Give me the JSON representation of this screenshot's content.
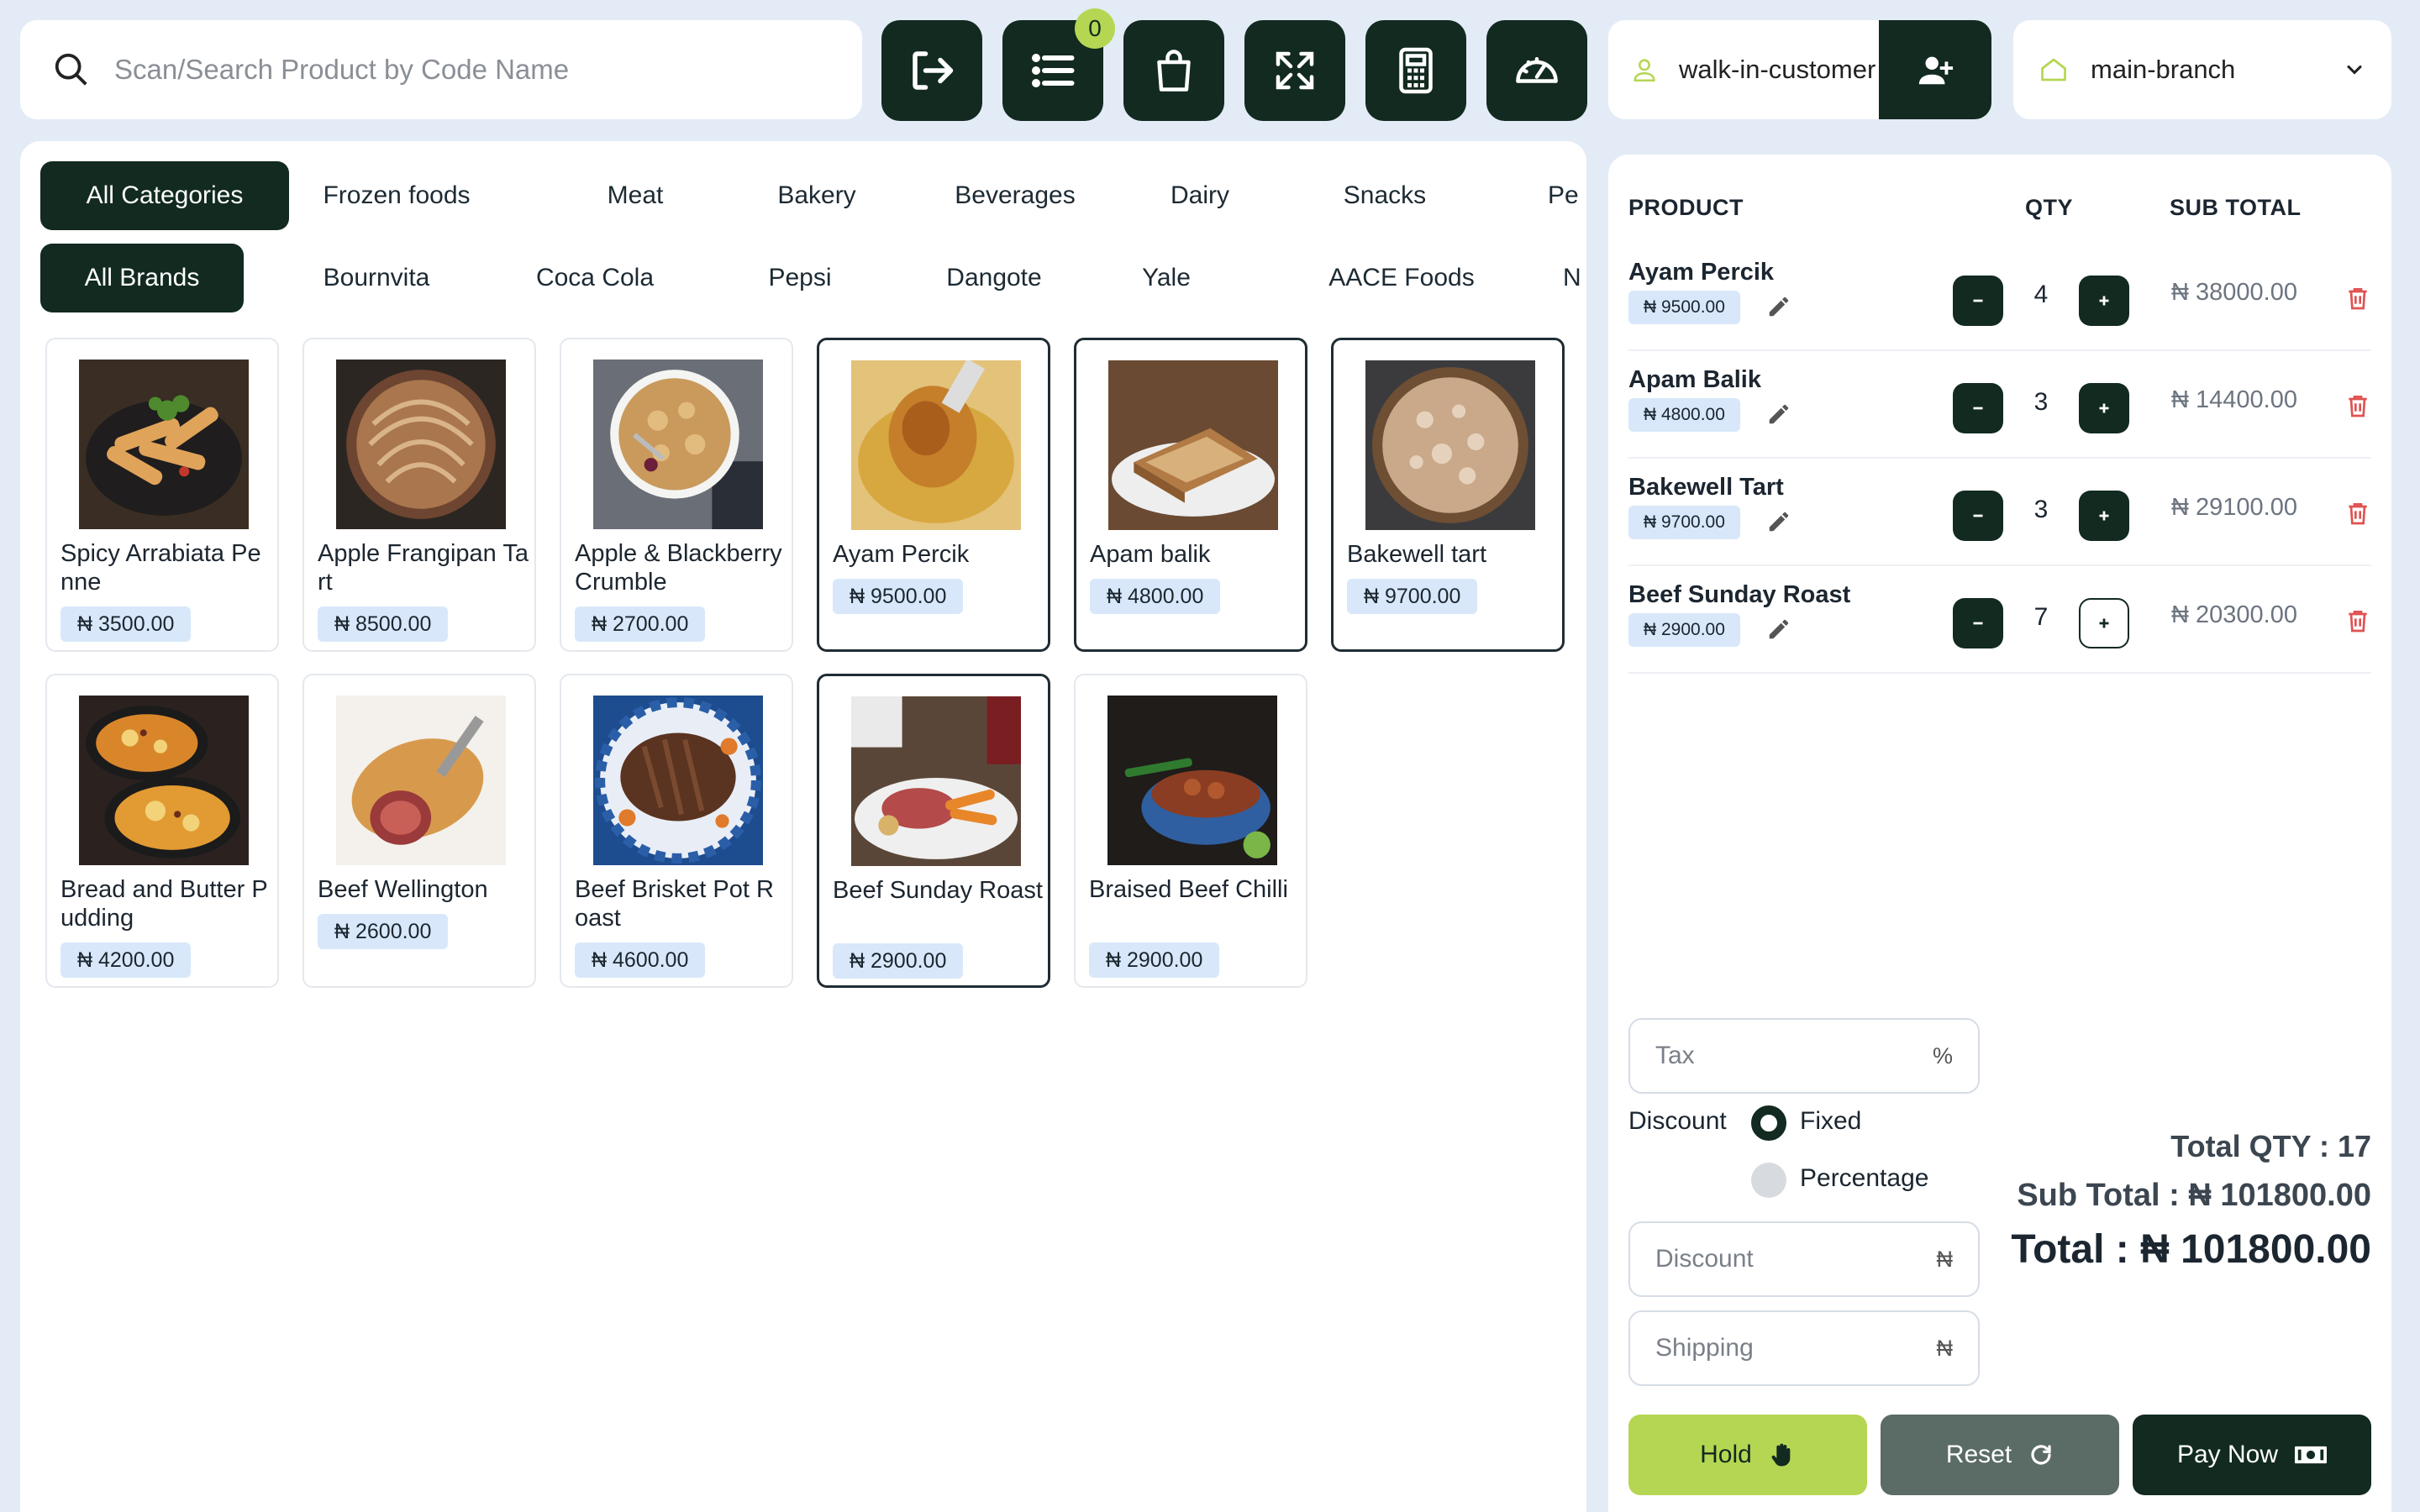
{
  "search": {
    "placeholder": "Scan/Search Product by Code Name",
    "value": ""
  },
  "toolbar": {
    "held_count": "0"
  },
  "customer": {
    "value": "walk-in-customer"
  },
  "branch": {
    "value": "main-branch"
  },
  "categories": [
    "All Categories",
    "Frozen foods",
    "Meat",
    "Bakery",
    "Beverages",
    "Dairy",
    "Snacks",
    "Pe"
  ],
  "brands": [
    "All Brands",
    "Bournvita",
    "Coca Cola",
    "Pepsi",
    "Dangote",
    "Yale",
    "AACE Foods",
    "N"
  ],
  "products": [
    {
      "name": "Spicy Arrabiata Penne",
      "price": "₦ 3500.00"
    },
    {
      "name": "Apple Frangipan Tart",
      "price": "₦ 8500.00"
    },
    {
      "name": "Apple & Blackberry Crumble",
      "price": "₦ 2700.00"
    },
    {
      "name": "Ayam Percik",
      "price": "₦ 9500.00"
    },
    {
      "name": "Apam balik",
      "price": "₦ 4800.00"
    },
    {
      "name": "Bakewell tart",
      "price": "₦ 9700.00"
    },
    {
      "name": "Bread and Butter Pudding",
      "price": "₦ 4200.00"
    },
    {
      "name": "Beef Wellington",
      "price": "₦ 2600.00"
    },
    {
      "name": "Beef Brisket Pot Roast",
      "price": "₦ 4600.00"
    },
    {
      "name": "Beef Sunday Roast",
      "price": "₦ 2900.00"
    },
    {
      "name": "Braised Beef Chilli",
      "price": "₦ 2900.00"
    }
  ],
  "cart": {
    "headers": {
      "product": "PRODUCT",
      "qty": "QTY",
      "subtotal": "SUB TOTAL"
    },
    "items": [
      {
        "name": "Ayam Percik",
        "price": "₦ 9500.00",
        "qty": "4",
        "subtotal": "₦ 38000.00"
      },
      {
        "name": "Apam Balik",
        "price": "₦ 4800.00",
        "qty": "3",
        "subtotal": "₦ 14400.00"
      },
      {
        "name": "Bakewell Tart",
        "price": "₦ 9700.00",
        "qty": "3",
        "subtotal": "₦ 29100.00"
      },
      {
        "name": "Beef Sunday Roast",
        "price": "₦ 2900.00",
        "qty": "7",
        "subtotal": "₦ 20300.00"
      }
    ]
  },
  "summary": {
    "tax_placeholder": "Tax",
    "tax_suffix": "%",
    "discount_label": "Discount",
    "fixed_label": "Fixed",
    "percentage_label": "Percentage",
    "discount_placeholder": "Discount",
    "shipping_placeholder": "Shipping",
    "currency_suffix": "₦",
    "total_qty": "Total QTY : 17",
    "sub_total": "Sub Total : ₦ 101800.00",
    "total": "Total : ₦ 101800.00"
  },
  "actions": {
    "hold": "Hold",
    "reset": "Reset",
    "pay": "Pay Now"
  },
  "colors": {
    "dark_green": "#122a20",
    "lime": "#b5d653",
    "slate": "#5b6b66",
    "price_chip": "#d8e8fa",
    "delete_red": "#e05252"
  }
}
